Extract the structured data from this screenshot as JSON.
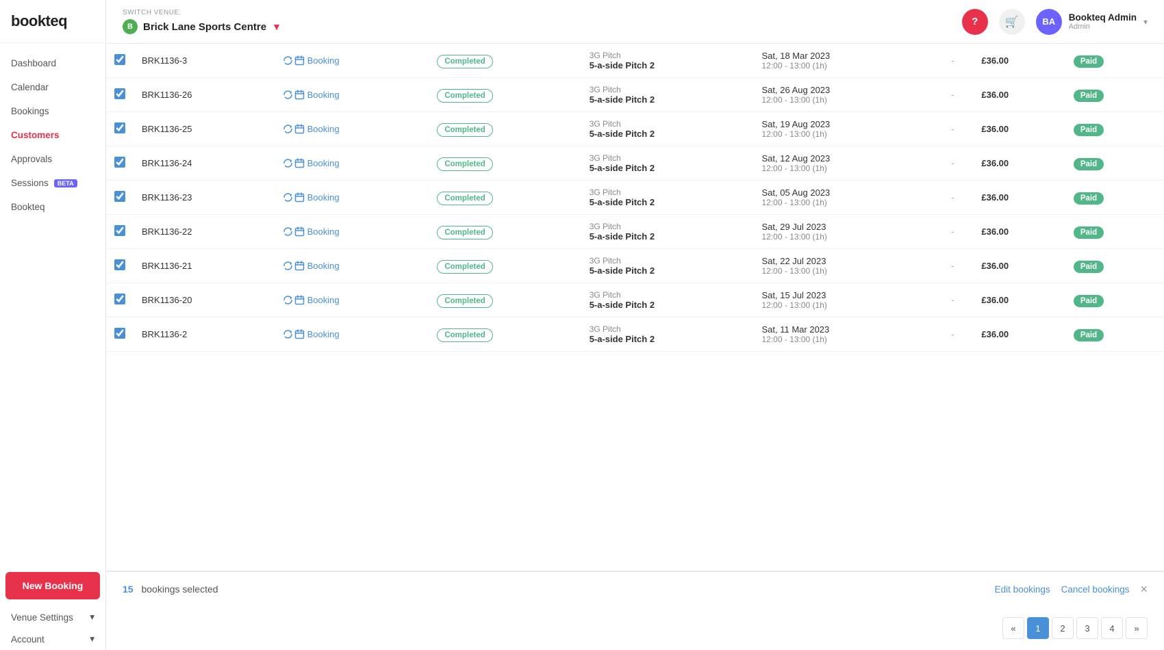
{
  "app": {
    "logo": "bookteq"
  },
  "header": {
    "switch_venue_label": "SWITCH VENUE:",
    "venue_icon_letter": "B",
    "venue_name": "Brick Lane Sports Centre",
    "venue_dropdown_arrow": "▼",
    "help_label": "?",
    "cart_icon": "🛒",
    "user_initials": "BA",
    "user_name": "Bookteq Admin",
    "user_role": "Admin",
    "user_chevron": "▾"
  },
  "sidebar": {
    "items": [
      {
        "label": "Dashboard",
        "active": false
      },
      {
        "label": "Calendar",
        "active": false
      },
      {
        "label": "Bookings",
        "active": false
      },
      {
        "label": "Customers",
        "active": true
      },
      {
        "label": "Approvals",
        "active": false
      },
      {
        "label": "Sessions",
        "active": false,
        "beta": true
      },
      {
        "label": "Bookteq",
        "active": false
      }
    ],
    "sections": [
      {
        "label": "Venue Settings",
        "expanded": false
      },
      {
        "label": "Account",
        "expanded": false
      }
    ],
    "new_booking_label": "New Booking"
  },
  "table": {
    "rows": [
      {
        "id": "BRK1136-3",
        "type": "Booking",
        "status": "Completed",
        "facility_category": "3G Pitch",
        "facility_name": "5-a-side Pitch 2",
        "date": "Sat, 18 Mar 2023",
        "time": "12:00 - 13:00 (1h)",
        "dash": "-",
        "price": "£36.00",
        "payment": "Paid",
        "checked": true
      },
      {
        "id": "BRK1136-26",
        "type": "Booking",
        "status": "Completed",
        "facility_category": "3G Pitch",
        "facility_name": "5-a-side Pitch 2",
        "date": "Sat, 26 Aug 2023",
        "time": "12:00 - 13:00 (1h)",
        "dash": "-",
        "price": "£36.00",
        "payment": "Paid",
        "checked": true
      },
      {
        "id": "BRK1136-25",
        "type": "Booking",
        "status": "Completed",
        "facility_category": "3G Pitch",
        "facility_name": "5-a-side Pitch 2",
        "date": "Sat, 19 Aug 2023",
        "time": "12:00 - 13:00 (1h)",
        "dash": "-",
        "price": "£36.00",
        "payment": "Paid",
        "checked": true
      },
      {
        "id": "BRK1136-24",
        "type": "Booking",
        "status": "Completed",
        "facility_category": "3G Pitch",
        "facility_name": "5-a-side Pitch 2",
        "date": "Sat, 12 Aug 2023",
        "time": "12:00 - 13:00 (1h)",
        "dash": "-",
        "price": "£36.00",
        "payment": "Paid",
        "checked": true
      },
      {
        "id": "BRK1136-23",
        "type": "Booking",
        "status": "Completed",
        "facility_category": "3G Pitch",
        "facility_name": "5-a-side Pitch 2",
        "date": "Sat, 05 Aug 2023",
        "time": "12:00 - 13:00 (1h)",
        "dash": "-",
        "price": "£36.00",
        "payment": "Paid",
        "checked": true
      },
      {
        "id": "BRK1136-22",
        "type": "Booking",
        "status": "Completed",
        "facility_category": "3G Pitch",
        "facility_name": "5-a-side Pitch 2",
        "date": "Sat, 29 Jul 2023",
        "time": "12:00 - 13:00 (1h)",
        "dash": "-",
        "price": "£36.00",
        "payment": "Paid",
        "checked": true
      },
      {
        "id": "BRK1136-21",
        "type": "Booking",
        "status": "Completed",
        "facility_category": "3G Pitch",
        "facility_name": "5-a-side Pitch 2",
        "date": "Sat, 22 Jul 2023",
        "time": "12:00 - 13:00 (1h)",
        "dash": "-",
        "price": "£36.00",
        "payment": "Paid",
        "checked": true
      },
      {
        "id": "BRK1136-20",
        "type": "Booking",
        "status": "Completed",
        "facility_category": "3G Pitch",
        "facility_name": "5-a-side Pitch 2",
        "date": "Sat, 15 Jul 2023",
        "time": "12:00 - 13:00 (1h)",
        "dash": "-",
        "price": "£36.00",
        "payment": "Paid",
        "checked": true
      },
      {
        "id": "BRK1136-2",
        "type": "Booking",
        "status": "Completed",
        "facility_category": "3G Pitch",
        "facility_name": "5-a-side Pitch 2",
        "date": "Sat, 11 Mar 2023",
        "time": "12:00 - 13:00 (1h)",
        "dash": "-",
        "price": "£36.00",
        "payment": "Paid",
        "checked": true
      }
    ]
  },
  "bottom_bar": {
    "selected_count": "15",
    "selected_text": "bookings selected",
    "edit_bookings_label": "Edit bookings",
    "cancel_bookings_label": "Cancel bookings",
    "close_symbol": "×"
  },
  "pagination": {
    "prev_arrow": "«",
    "next_arrow": "»",
    "pages": [
      "1",
      "2",
      "3",
      "4"
    ],
    "active_page": "1"
  }
}
